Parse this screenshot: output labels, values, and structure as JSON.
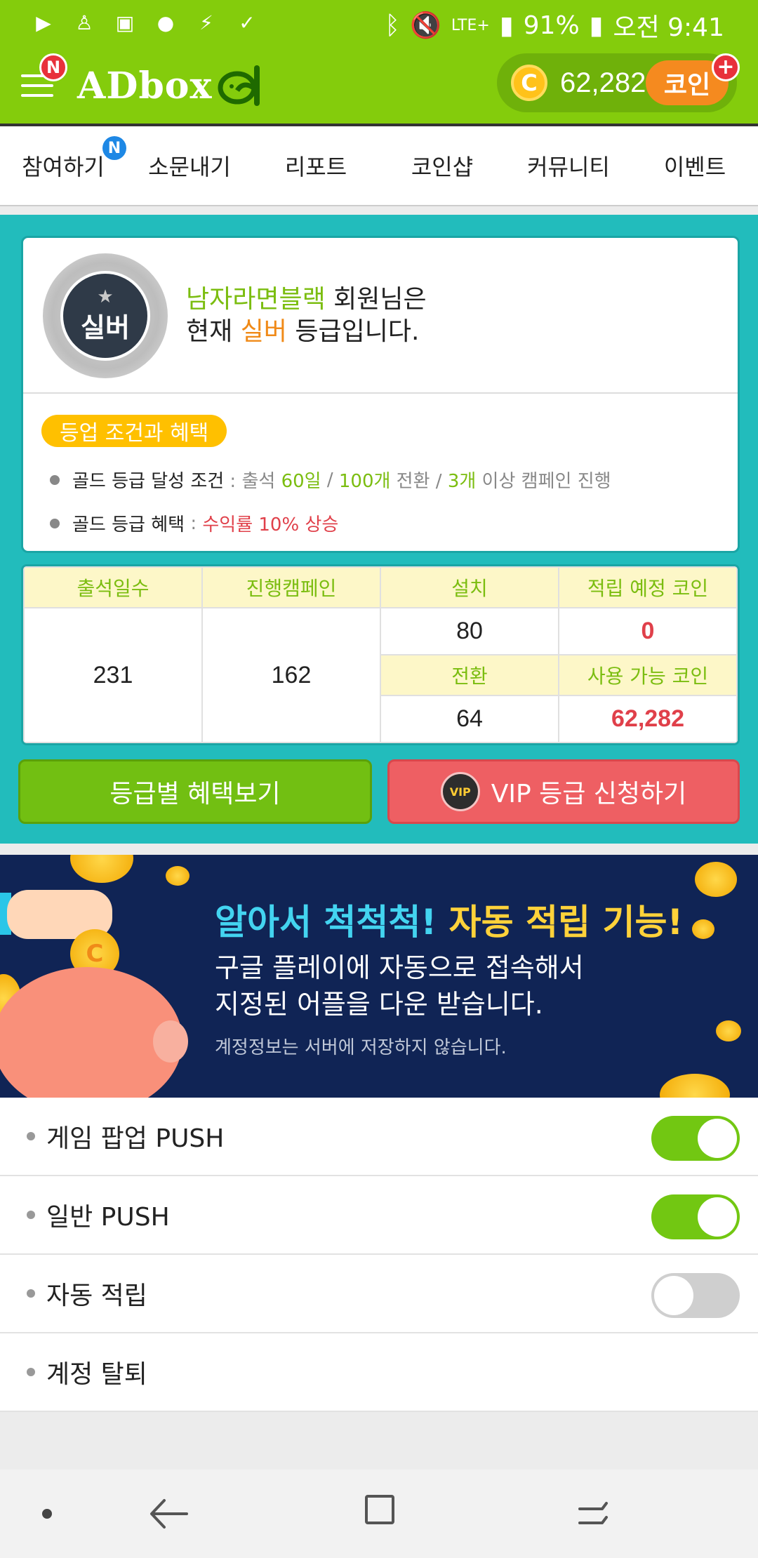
{
  "status_bar": {
    "battery": "91%",
    "time": "오전 9:41",
    "network": "LTE+"
  },
  "header": {
    "menu_badge": "N",
    "logo": "ADbox",
    "coin_symbol": "C",
    "coin_amount": "62,282",
    "coin_button": "코인",
    "plus": "+"
  },
  "tabs": [
    {
      "label": "참여하기",
      "badge": "N"
    },
    {
      "label": "소문내기"
    },
    {
      "label": "리포트"
    },
    {
      "label": "코인샵"
    },
    {
      "label": "커뮤니티"
    },
    {
      "label": "이벤트"
    }
  ],
  "grade_card": {
    "medal_label": "실버",
    "nickname": "남자라면블랙",
    "line1_suffix": " 회원님은",
    "line2_prefix": "현재 ",
    "grade": "실버",
    "line2_suffix": " 등급입니다.",
    "chip": "등업 조건과 혜택",
    "cond_label": "골드 등급 달성 조건",
    "cond_sep": " : 출석 ",
    "cond_days": "60일",
    "cond_slash1": " / ",
    "cond_conv": "100개",
    "cond_conv_text": " 전환 / ",
    "cond_camp": "3개",
    "cond_tail": " 이상 캠페인 진행",
    "benefit_label": "골드 등급 혜택",
    "benefit_sep": " : ",
    "benefit_value": "수익률 10% 상승"
  },
  "stats": {
    "headers": {
      "attendance": "출석일수",
      "campaigns": "진행캠페인",
      "install": "설치",
      "expected_coin": "적립 예정 코인",
      "conversion": "전환",
      "usable_coin": "사용 가능 코인"
    },
    "values": {
      "attendance": "231",
      "campaigns": "162",
      "install": "80",
      "expected_coin": "0",
      "conversion": "64",
      "usable_coin": "62,282"
    }
  },
  "buttons": {
    "benefits": "등급별 혜택보기",
    "vip": "VIP 등급 신청하기",
    "vip_icon": "VIP"
  },
  "banner": {
    "title_a": "알아서 척척척! ",
    "title_b": "자동 적립 기능!",
    "line1": "구글 플레이에 자동으로 접속해서",
    "line2": "지정된 어플을 다운 받습니다.",
    "note": "계정정보는 서버에 저장하지 않습니다.",
    "coin_symbol": "C"
  },
  "settings": [
    {
      "label": "게임 팝업 PUSH",
      "toggle": "on"
    },
    {
      "label": "일반 PUSH",
      "toggle": "on"
    },
    {
      "label": "자동 적립",
      "toggle": "off"
    },
    {
      "label": "계정 탈퇴"
    }
  ],
  "colors": {
    "brand_green": "#84cc0c",
    "teal": "#22bcbc",
    "accent_orange": "#f08a18",
    "accent_red": "#e0404a"
  }
}
